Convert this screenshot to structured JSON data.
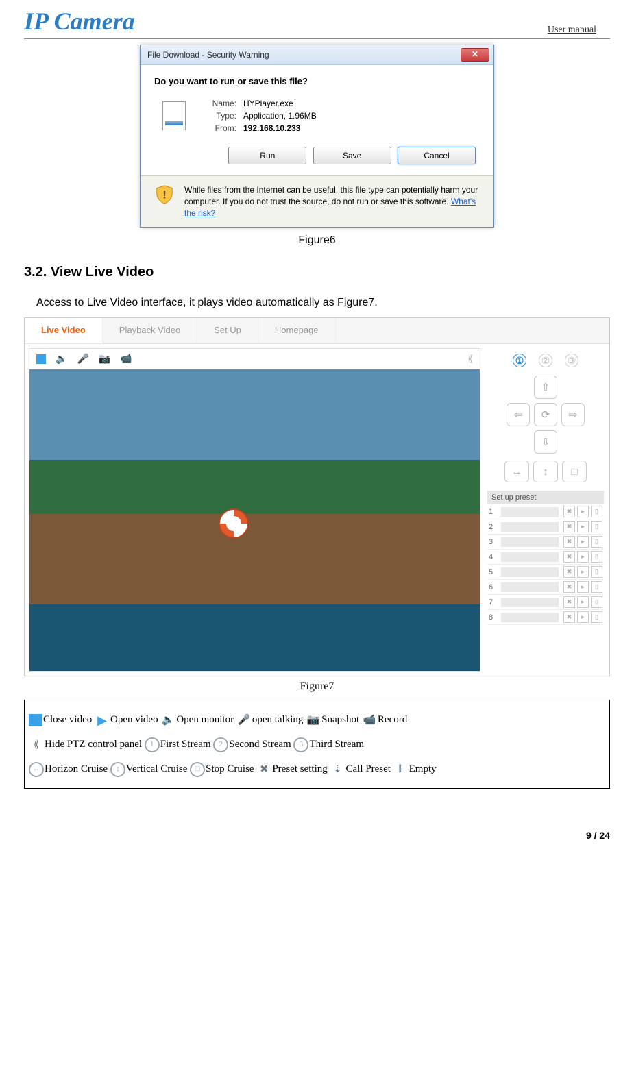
{
  "header": {
    "logo_text": "IP Camera",
    "right_label": "User manual"
  },
  "dialog": {
    "title": "File Download - Security Warning",
    "question": "Do you want to run or save this file?",
    "fields": {
      "name_label": "Name:",
      "name_value": "HYPlayer.exe",
      "type_label": "Type:",
      "type_value": "Application, 1.96MB",
      "from_label": "From:",
      "from_value": "192.168.10.233"
    },
    "buttons": {
      "run": "Run",
      "save": "Save",
      "cancel": "Cancel"
    },
    "warning_text": "While files from the Internet can be useful, this file type can potentially harm your computer. If you do not trust the source, do not run or save this software. ",
    "warning_link": "What's the risk?"
  },
  "captions": {
    "fig6": "Figure6",
    "fig7": "Figure7"
  },
  "section": {
    "heading": "3.2. View Live Video",
    "intro": "Access to Live Video interface, it plays video automatically as Figure7."
  },
  "live": {
    "tabs": {
      "live": "Live Video",
      "playback": "Playback Video",
      "setup": "Set Up",
      "homepage": "Homepage"
    },
    "streams": {
      "s1": "①",
      "s2": "②",
      "s3": "③"
    },
    "ptz": {
      "up": "⇧",
      "down": "⇩",
      "left": "⇦",
      "right": "⇨",
      "center": "⟳",
      "hcruise": "↔",
      "vcruise": "↕",
      "stop": "□"
    },
    "preset_title": "Set up preset",
    "presets": [
      "1",
      "2",
      "3",
      "4",
      "5",
      "6",
      "7",
      "8"
    ]
  },
  "legend": [
    {
      "icon": "close-sq",
      "label": "Close video"
    },
    {
      "icon": "play",
      "glyph": "▶",
      "label": "Open video"
    },
    {
      "icon": "plain",
      "glyph": "🔈",
      "label": "Open monitor"
    },
    {
      "icon": "plain",
      "glyph": "🎤",
      "label": "open talking"
    },
    {
      "icon": "plain",
      "glyph": "📷",
      "label": "Snapshot"
    },
    {
      "icon": "plain",
      "glyph": "📹",
      "label": "Record"
    },
    {
      "icon": "plain",
      "glyph": "⟪",
      "label": "Hide PTZ control panel"
    },
    {
      "icon": "circled",
      "glyph": "1",
      "label": "First Stream"
    },
    {
      "icon": "circled",
      "glyph": "2",
      "label": "Second Stream"
    },
    {
      "icon": "circled",
      "glyph": "3",
      "label": "Third Stream"
    },
    {
      "icon": "circled",
      "glyph": "↔",
      "label": "Horizon Cruise"
    },
    {
      "icon": "circled",
      "glyph": "↕",
      "label": "Vertical Cruise"
    },
    {
      "icon": "circled",
      "glyph": "□",
      "label": "Stop Cruise"
    },
    {
      "icon": "plain",
      "glyph": "✖",
      "label": "Preset setting"
    },
    {
      "icon": "plain",
      "glyph": "⇣",
      "label": "Call Preset"
    },
    {
      "icon": "plain",
      "glyph": "⦀",
      "label": "Empty"
    }
  ],
  "footer": {
    "page_current": "9",
    "page_sep": " / ",
    "page_total": "24"
  }
}
